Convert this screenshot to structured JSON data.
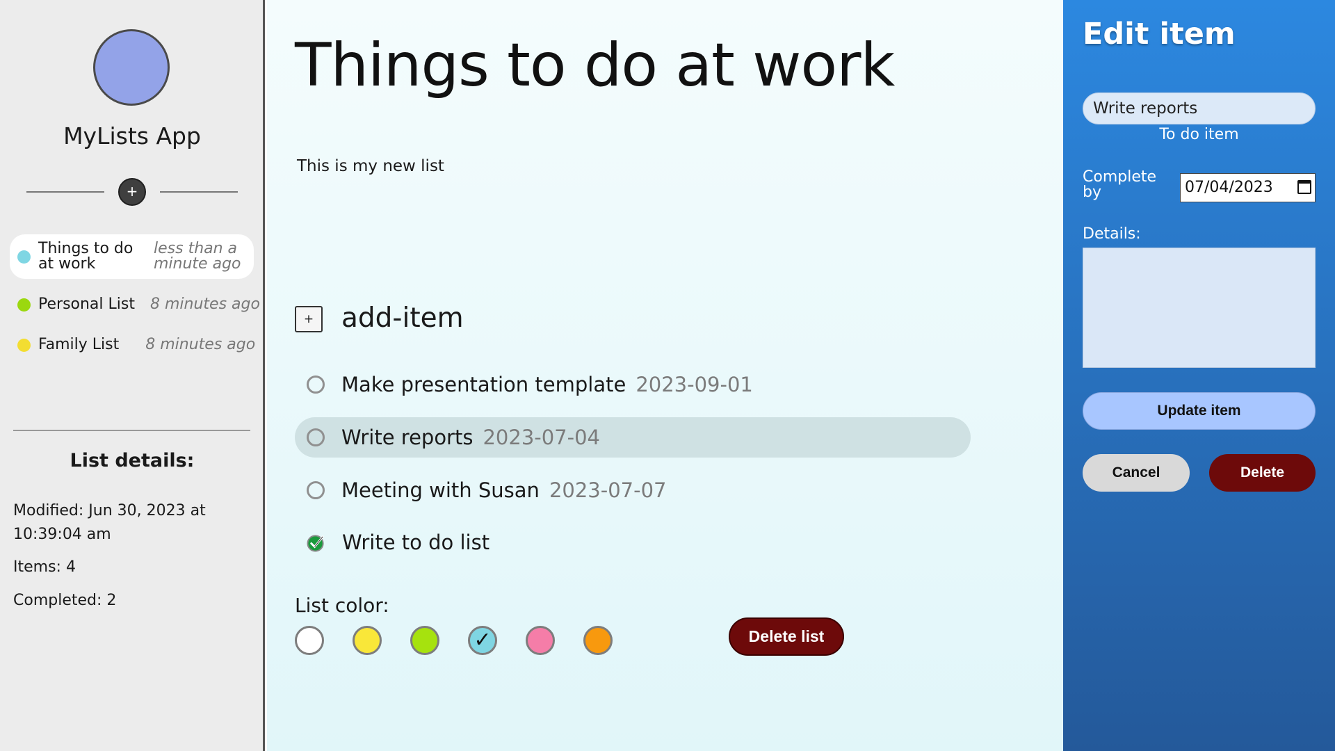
{
  "sidebar": {
    "app_name": "MyLists App",
    "add_list_label": "+",
    "lists": [
      {
        "name_line1": "Things to do",
        "name_line2": "at work",
        "time_line1": "less than a",
        "time_line2": "minute ago",
        "color": "#7fd6e3",
        "active": true
      },
      {
        "name": "Personal List",
        "time": "8 minutes ago",
        "color": "#9bd80f",
        "active": false
      },
      {
        "name": "Family List",
        "time": "8 minutes ago",
        "color": "#f3dd31",
        "active": false
      }
    ],
    "details": {
      "title": "List details:",
      "modified": "Modified: Jun 30, 2023 at 10:39:04 am",
      "items": "Items: 4",
      "completed": "Completed: 2"
    }
  },
  "main": {
    "title": "Things to do at work",
    "description": "This is my new list",
    "add_item_icon": "+",
    "add_item_label": "add-item",
    "items": [
      {
        "name": "Make presentation template",
        "date": "2023-09-01",
        "done": false,
        "selected": false
      },
      {
        "name": "Write reports",
        "date": "2023-07-04",
        "done": false,
        "selected": true
      },
      {
        "name": "Meeting with Susan",
        "date": "2023-07-07",
        "done": false,
        "selected": false
      },
      {
        "name": "Write to do list",
        "date": "",
        "done": true,
        "selected": false
      }
    ],
    "color_label": "List color:",
    "colors": [
      {
        "name": "white",
        "hex": "#ffffff",
        "selected": false
      },
      {
        "name": "yellow",
        "hex": "#f9e739",
        "selected": false
      },
      {
        "name": "green",
        "hex": "#a6e20e",
        "selected": false
      },
      {
        "name": "cyan",
        "hex": "#7fd6e3",
        "selected": true
      },
      {
        "name": "pink",
        "hex": "#f57da8",
        "selected": false
      },
      {
        "name": "orange",
        "hex": "#f8990e",
        "selected": false
      }
    ],
    "selected_check": "✓",
    "delete_list_label": "Delete list"
  },
  "edit_panel": {
    "title": "Edit item",
    "name_value": "Write reports",
    "item_type": "To do item",
    "complete_by_label": "Complete by",
    "complete_by_value": "07/04/2023",
    "details_label": "Details:",
    "details_value": "",
    "update_label": "Update item",
    "cancel_label": "Cancel",
    "delete_label": "Delete"
  },
  "colors": {
    "accent_delete": "#6d0a0a",
    "panel_top": "#2c88e0",
    "panel_bottom": "#24599a",
    "update_button": "#a8c6ff",
    "check_green": "#1a9a3c"
  }
}
